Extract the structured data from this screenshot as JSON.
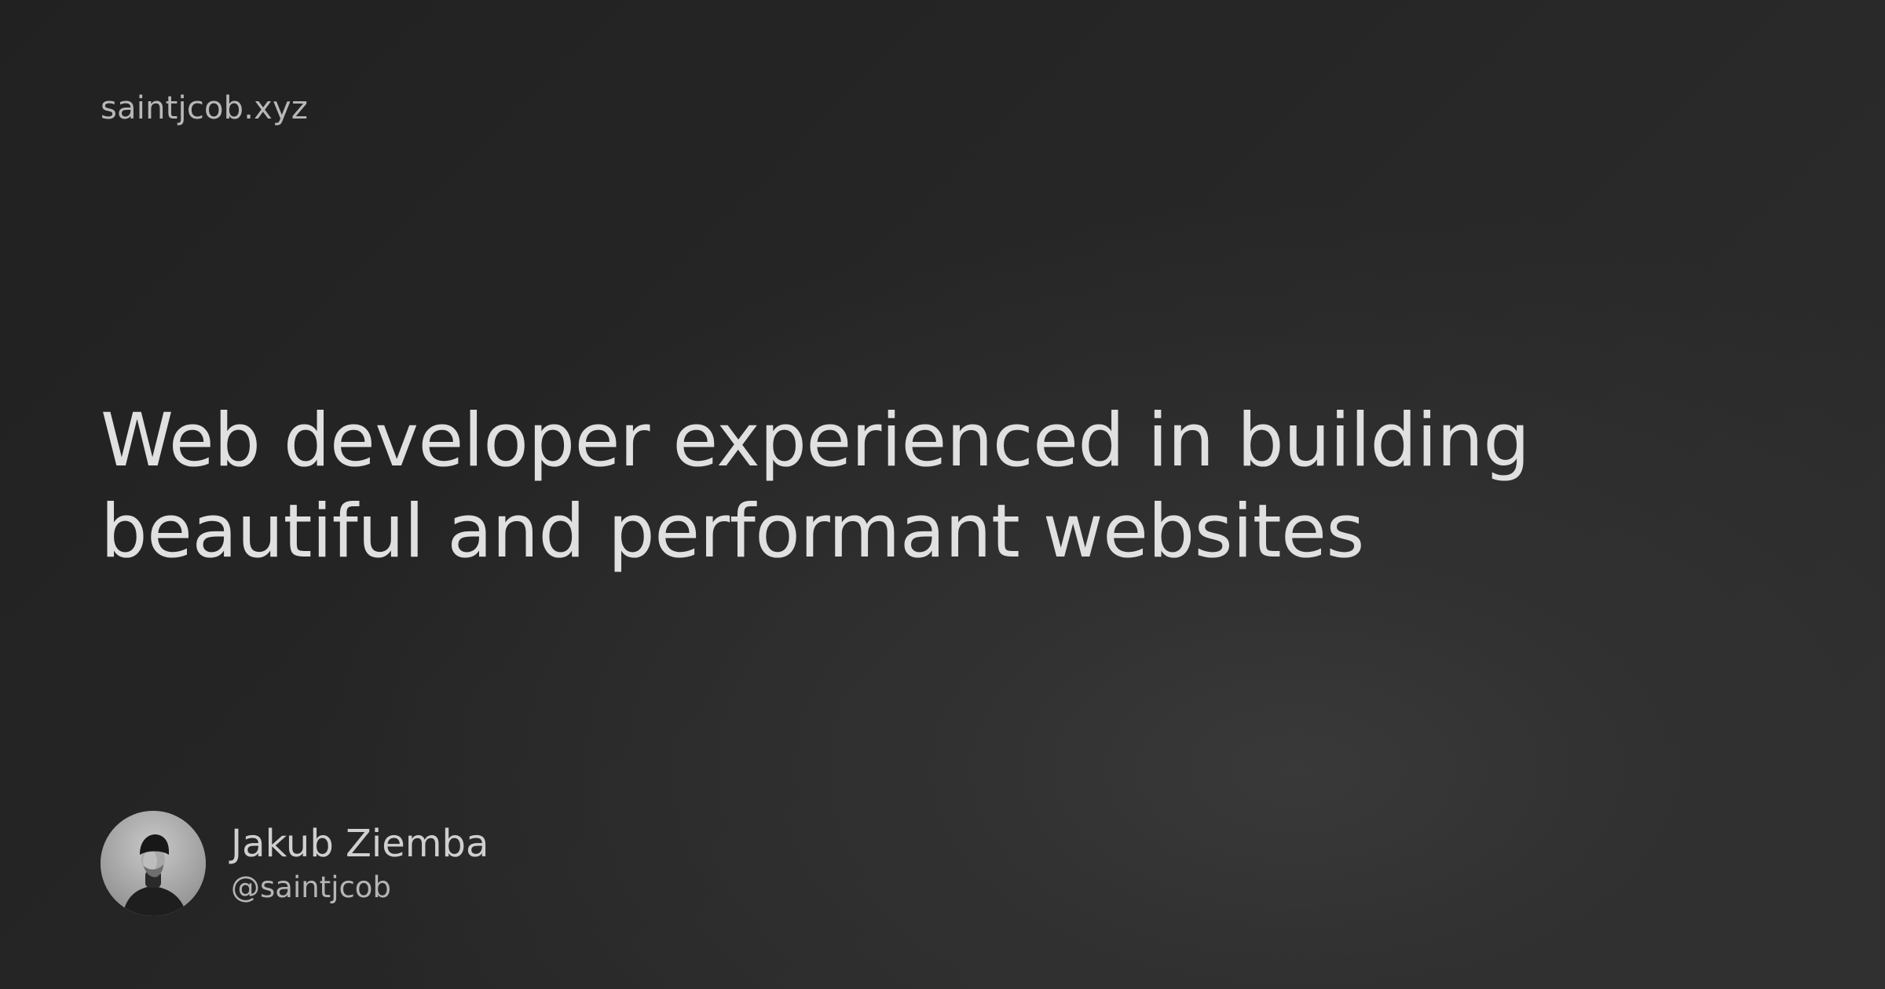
{
  "site": {
    "domain": "saintjcob.xyz"
  },
  "hero": {
    "headline_line1": "Web developer experienced in building",
    "headline_line2": "beautiful and performant websites"
  },
  "author": {
    "name": "Jakub Ziemba",
    "handle": "@saintjcob",
    "avatar_icon": "person-portrait-icon"
  },
  "colors": {
    "background_dark": "#222222",
    "background_light": "#393939",
    "headline_text": "#e0e0e0",
    "secondary_text": "#b8b8b8"
  }
}
